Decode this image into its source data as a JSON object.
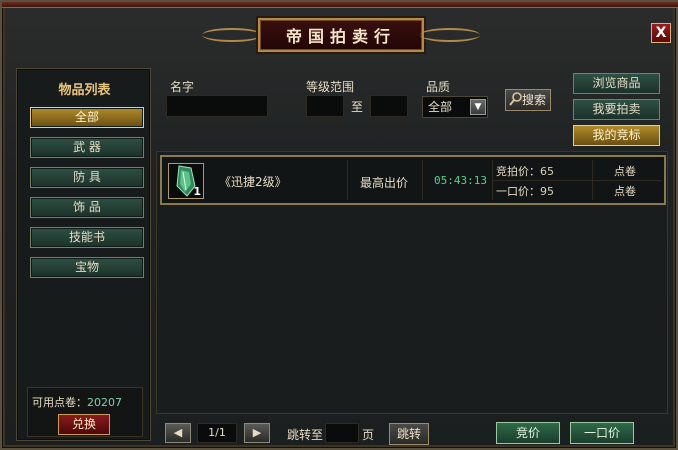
{
  "window": {
    "title": "帝国拍卖行",
    "close_label": "X"
  },
  "sidebar": {
    "title": "物品列表",
    "categories": [
      {
        "label": "全部",
        "active": true
      },
      {
        "label": "武 器",
        "active": false
      },
      {
        "label": "防 具",
        "active": false
      },
      {
        "label": "饰 品",
        "active": false
      },
      {
        "label": "技能书",
        "active": false
      },
      {
        "label": "宝物",
        "active": false
      }
    ],
    "points_label": "可用点卷：",
    "points_value": "20207",
    "exchange_label": "兑换"
  },
  "search": {
    "name_label": "名字",
    "name_value": "",
    "level_label": "等级范围",
    "level_min": "",
    "level_to": "至",
    "level_max": "",
    "quality_label": "品质",
    "quality_value": "全部",
    "search_label": "搜索"
  },
  "side_buttons": [
    {
      "label": "浏览商品",
      "active": false
    },
    {
      "label": "我要拍卖",
      "active": false
    },
    {
      "label": "我的竞标",
      "active": true
    }
  ],
  "results": [
    {
      "icon": "green-crystal-icon",
      "quantity": "1",
      "name": "《迅捷2级》",
      "status": "最高出价",
      "timer": "05:43:13",
      "bid_label": "竞拍价：",
      "bid_price": "65",
      "buyout_label": "一口价：",
      "buyout_price": "95",
      "bid_unit": "点卷",
      "buyout_unit": "点卷"
    }
  ],
  "pagination": {
    "prev": "◀",
    "page": "1/1",
    "next": "▶",
    "jump_label": "跳转至",
    "jump_value": "",
    "page_unit": "页",
    "jump_button": "跳转"
  },
  "actions": {
    "bid": "竞价",
    "buyout": "一口价"
  },
  "colors": {
    "accent_gold": "#b08a2a",
    "button_green": "#2f5044",
    "timer_green": "#52d28a",
    "points_green": "#7fd0a8"
  }
}
